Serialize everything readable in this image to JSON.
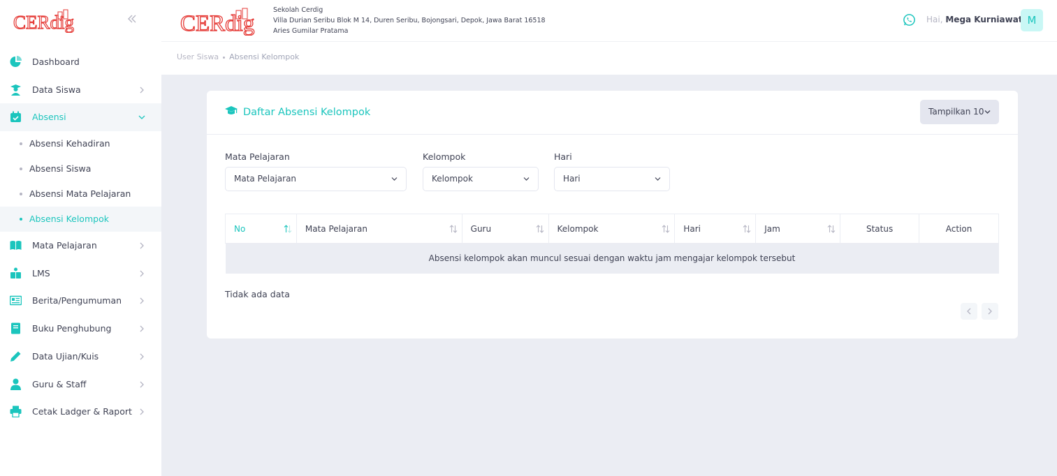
{
  "brand": {
    "logo_text": "CERdig",
    "accent": "#1bc5bd",
    "logo_color": "#e53935"
  },
  "sidebar": {
    "collapse_icon": "double-chevron-left-icon",
    "items": [
      {
        "label": "Dashboard",
        "icon": "pie-chart-icon"
      },
      {
        "label": "Data Siswa",
        "icon": "student-icon"
      },
      {
        "label": "Absensi",
        "icon": "calendar-check-icon",
        "expanded": true
      },
      {
        "label": "Mata Pelajaran",
        "icon": "book-open-icon"
      },
      {
        "label": "LMS",
        "icon": "lms-icon"
      },
      {
        "label": "Berita/Pengumuman",
        "icon": "newspaper-icon"
      },
      {
        "label": "Buku Penghubung",
        "icon": "notebook-icon"
      },
      {
        "label": "Data Ujian/Kuis",
        "icon": "pencil-icon"
      },
      {
        "label": "Guru & Staff",
        "icon": "user-tie-icon"
      },
      {
        "label": "Cetak Ladger & Raport",
        "icon": "printer-icon"
      }
    ],
    "absensi_sub": [
      {
        "label": "Absensi Kehadiran"
      },
      {
        "label": "Absensi Siswa"
      },
      {
        "label": "Absensi Mata Pelajaran"
      },
      {
        "label": "Absensi Kelompok",
        "active": true
      }
    ]
  },
  "header": {
    "school_name": "Sekolah Cerdig",
    "school_address": "Villa Durian Seribu Blok M 14, Duren Seribu, Bojongsari, Depok, Jawa Barat 16518",
    "school_head": "Aries Gumilar Pratama",
    "greeting": "Hai,",
    "user_name": "Mega Kurniawati",
    "avatar_letter": "M"
  },
  "breadcrumb": {
    "parent": "User Siswa",
    "current": "Absensi Kelompok"
  },
  "card": {
    "title": "Daftar Absensi Kelompok",
    "show_label": "Tampilkan 10",
    "filters": {
      "mapel_label": "Mata Pelajaran",
      "mapel_value": "Mata Pelajaran",
      "kelompok_label": "Kelompok",
      "kelompok_value": "Kelompok",
      "hari_label": "Hari",
      "hari_value": "Hari"
    },
    "table": {
      "columns": [
        "No",
        "Mata Pelajaran",
        "Guru",
        "Kelompok",
        "Hari",
        "Jam",
        "Status",
        "Action"
      ],
      "empty_message": "Absensi kelompok akan muncul sesuai dengan waktu jam mengajar kelompok tersebut"
    },
    "info": "Tidak ada data"
  }
}
